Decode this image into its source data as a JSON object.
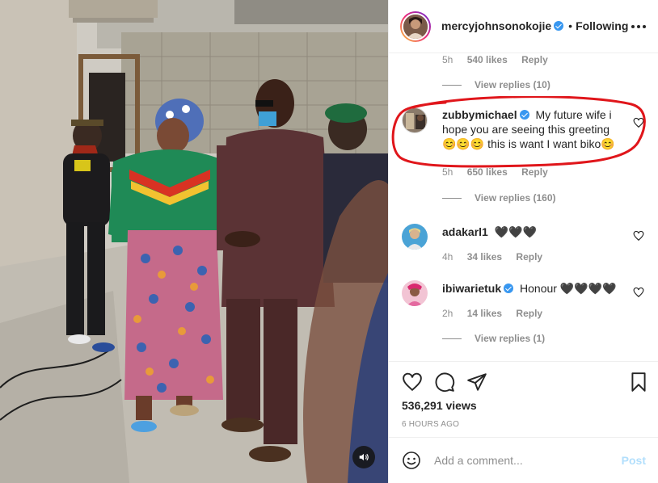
{
  "header": {
    "username": "mercyjohnsonokojie",
    "separator": "•",
    "follow_status": "Following",
    "more_icon": "more-horizontal-icon"
  },
  "comments": {
    "top_meta": {
      "time": "5h",
      "likes": "540 likes",
      "reply": "Reply"
    },
    "top_view_replies": "View replies (10)",
    "items": [
      {
        "username": "zubbymichael",
        "verified": true,
        "text": "My future wife i hope you are seeing this greeting 😊😊😊 this is want I want biko😊",
        "time": "5h",
        "likes": "650 likes",
        "reply": "Reply",
        "view_replies": "View replies (160)",
        "highlighted": true
      },
      {
        "username": "adakarl1",
        "verified": false,
        "text": "🖤🖤🖤",
        "time": "4h",
        "likes": "34 likes",
        "reply": "Reply"
      },
      {
        "username": "ibiwarietuk",
        "verified": true,
        "text": "Honour 🖤🖤🖤🖤",
        "time": "2h",
        "likes": "14 likes",
        "reply": "Reply",
        "view_replies": "View replies (1)"
      }
    ]
  },
  "actions": {
    "icons": [
      "heart-icon",
      "comment-icon",
      "share-icon",
      "bookmark-icon"
    ],
    "views": "536,291 views",
    "time_ago": "6 HOURS AGO"
  },
  "add_comment": {
    "placeholder": "Add a comment...",
    "post_label": "Post"
  },
  "colors": {
    "accent": "#3897f0",
    "highlight_outline": "#e0161b",
    "post_disabled": "#b2dffc",
    "muted": "#8e8e8e"
  }
}
